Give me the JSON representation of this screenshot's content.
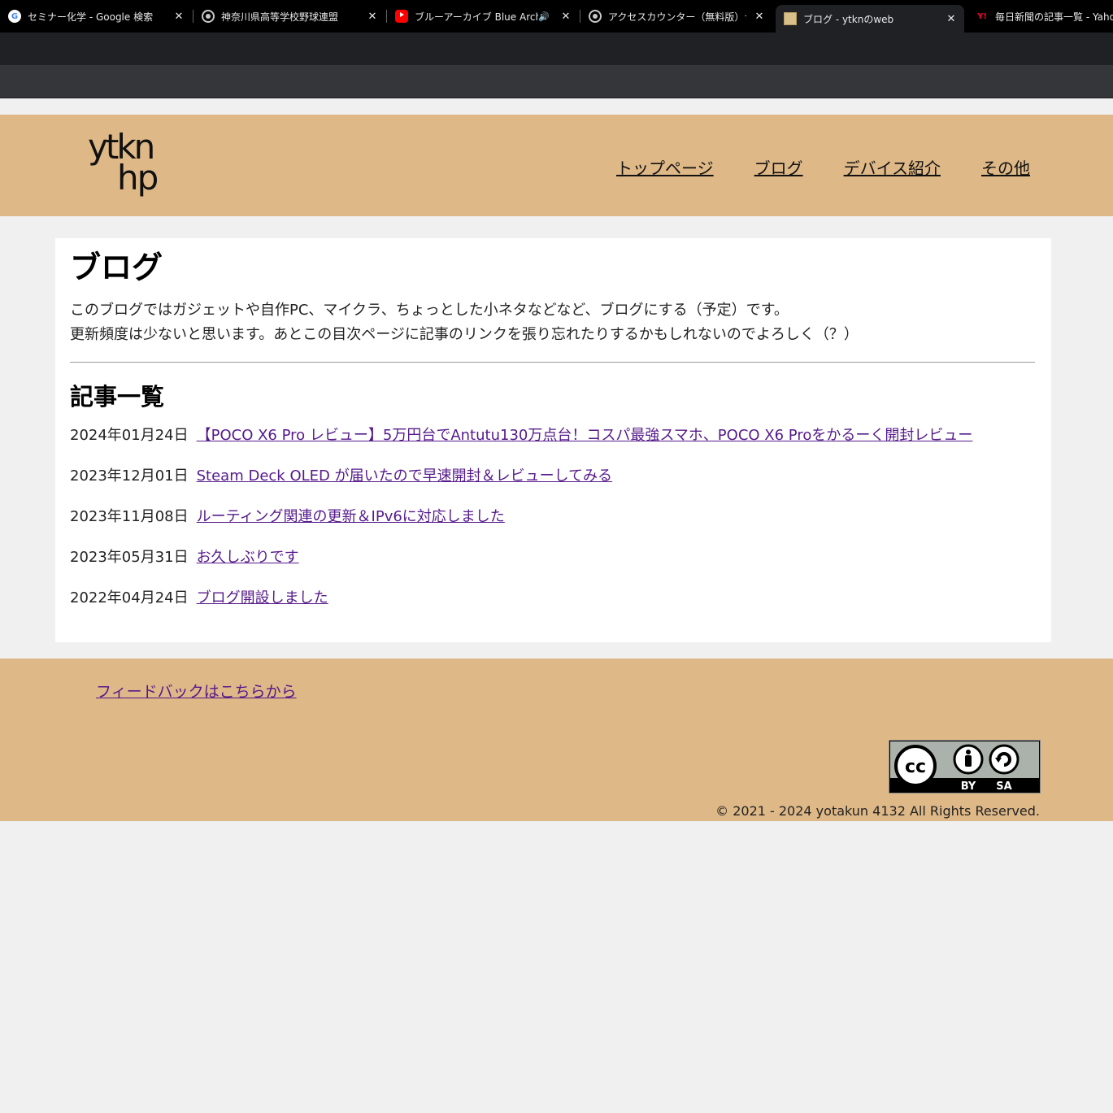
{
  "browser": {
    "tabs": [
      {
        "title": "セミナー化学 - Google 検索",
        "icon": "google-icon"
      },
      {
        "title": "神奈川県高等学校野球連盟",
        "icon": "globe-icon"
      },
      {
        "title": "ブルーアーカイブ Blue Archive",
        "icon": "youtube-icon",
        "audio": "🔊"
      },
      {
        "title": "アクセスカウンター（無料版）テキス",
        "icon": "globe-icon"
      },
      {
        "title": "ブログ - ytknのweb",
        "icon": "site-icon",
        "active": true
      },
      {
        "title": "毎日新聞の記事一覧 - Yahoo",
        "icon": "yahoo-icon"
      }
    ],
    "close_glyph": "✕",
    "google_glyph": "G",
    "yahoo_glyph": "Y!"
  },
  "header": {
    "logo_line1": "ytkn",
    "logo_line2": "hp",
    "nav": [
      "トップページ",
      "ブログ",
      "デバイス紹介",
      "その他"
    ]
  },
  "main": {
    "title": "ブログ",
    "intro": [
      "このブログではガジェットや自作PC、マイクラ、ちょっとした小ネタなどなど、ブログにする（予定）です。",
      "更新頻度は少ないと思います。あとこの目次ページに記事のリンクを張り忘れたりするかもしれないのでよろしく（？）"
    ],
    "list_heading": "記事一覧",
    "articles": [
      {
        "date": "2024年01月24日",
        "title": "【POCO X6 Pro レビュー】5万円台でAntutu130万点台！コスパ最強スマホ、POCO X6 Proをかるーく開封レビュー"
      },
      {
        "date": "2023年12月01日",
        "title": "Steam Deck OLED が届いたので早速開封＆レビューしてみる"
      },
      {
        "date": "2023年11月08日",
        "title": "ルーティング関連の更新＆IPv6に対応しました"
      },
      {
        "date": "2023年05月31日",
        "title": "お久しぶりです"
      },
      {
        "date": "2022年04月24日",
        "title": "ブログ開設しました"
      }
    ]
  },
  "footer": {
    "feedback": "フィードバックはこちらから",
    "license_badge": {
      "cc": "cc",
      "by": "BY",
      "sa": "SA"
    },
    "copyright": "© 2021 - 2024 yotakun 4132 All Rights Reserved."
  },
  "colors": {
    "header_bg": "#deb887",
    "page_bg": "#f0f0f0",
    "link_visited": "#551a8b"
  }
}
